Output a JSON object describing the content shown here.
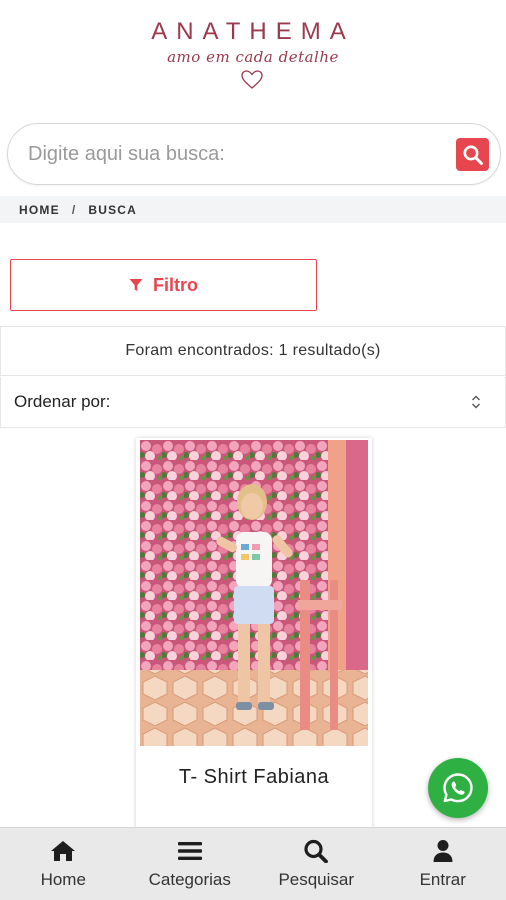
{
  "brand": {
    "name": "ANATHEMA",
    "tagline": "amo em cada detalhe"
  },
  "search": {
    "placeholder": "Digite aqui sua busca:",
    "value": ""
  },
  "breadcrumb": {
    "home": "HOME",
    "separator": "/",
    "current": "BUSCA"
  },
  "filter": {
    "label": "Filtro"
  },
  "results": {
    "text": "Foram encontrados: 1 resultado(s)"
  },
  "sort": {
    "label": "Ordenar por:"
  },
  "product": {
    "title": "T- Shirt Fabiana"
  },
  "bottom_nav": {
    "items": [
      {
        "label": "Home",
        "icon": "home-icon"
      },
      {
        "label": "Categorias",
        "icon": "menu-icon"
      },
      {
        "label": "Pesquisar",
        "icon": "search-icon"
      },
      {
        "label": "Entrar",
        "icon": "user-icon"
      }
    ]
  },
  "colors": {
    "brand": "#9b3a4e",
    "accent": "#e8464f",
    "whatsapp": "#2eb043"
  }
}
